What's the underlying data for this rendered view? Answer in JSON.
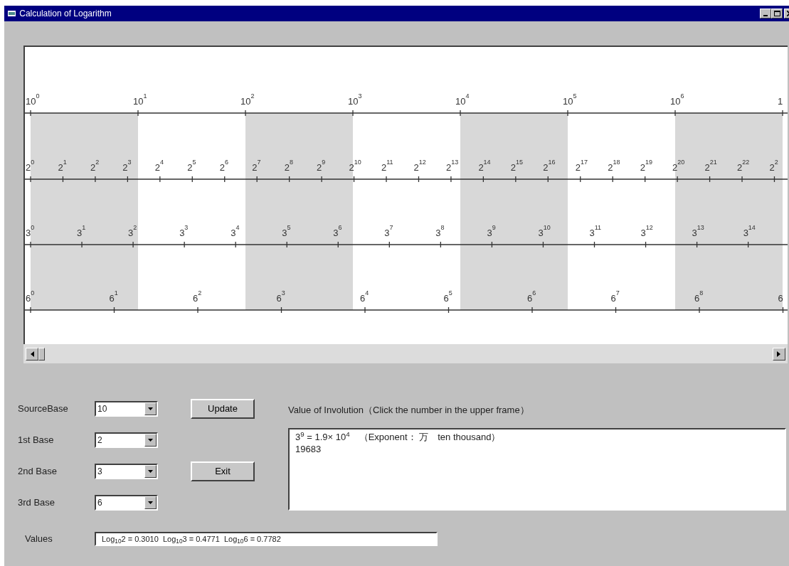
{
  "window": {
    "title": "Calculation of Logarithm"
  },
  "bands": [
    {
      "shaded": true
    },
    {
      "shaded": false
    },
    {
      "shaded": true
    },
    {
      "shaded": false
    },
    {
      "shaded": true
    },
    {
      "shaded": false
    },
    {
      "shaded": true
    }
  ],
  "scales": [
    {
      "labels": [
        {
          "base": "10",
          "exp": "0"
        },
        {
          "base": "10",
          "exp": "1"
        },
        {
          "base": "10",
          "exp": "2"
        },
        {
          "base": "10",
          "exp": "3"
        },
        {
          "base": "10",
          "exp": "4"
        },
        {
          "base": "10",
          "exp": "5"
        },
        {
          "base": "10",
          "exp": "6"
        },
        {
          "base": "1"
        }
      ]
    },
    {
      "labels": [
        {
          "base": "2",
          "exp": "0"
        },
        {
          "base": "2",
          "exp": "1"
        },
        {
          "base": "2",
          "exp": "2"
        },
        {
          "base": "2",
          "exp": "3"
        },
        {
          "base": "2",
          "exp": "4"
        },
        {
          "base": "2",
          "exp": "5"
        },
        {
          "base": "2",
          "exp": "6"
        },
        {
          "base": "2",
          "exp": "7"
        },
        {
          "base": "2",
          "exp": "8"
        },
        {
          "base": "2",
          "exp": "9"
        },
        {
          "base": "2",
          "exp": "10"
        },
        {
          "base": "2",
          "exp": "11"
        },
        {
          "base": "2",
          "exp": "12"
        },
        {
          "base": "2",
          "exp": "13"
        },
        {
          "base": "2",
          "exp": "14"
        },
        {
          "base": "2",
          "exp": "15"
        },
        {
          "base": "2",
          "exp": "16"
        },
        {
          "base": "2",
          "exp": "17"
        },
        {
          "base": "2",
          "exp": "18"
        },
        {
          "base": "2",
          "exp": "19"
        },
        {
          "base": "2",
          "exp": "20"
        },
        {
          "base": "2",
          "exp": "21"
        },
        {
          "base": "2",
          "exp": "22"
        },
        {
          "base": "2",
          "exp": "2"
        }
      ]
    },
    {
      "labels": [
        {
          "base": "3",
          "exp": "0"
        },
        {
          "base": "3",
          "exp": "1"
        },
        {
          "base": "3",
          "exp": "2"
        },
        {
          "base": "3",
          "exp": "3"
        },
        {
          "base": "3",
          "exp": "4"
        },
        {
          "base": "3",
          "exp": "5"
        },
        {
          "base": "3",
          "exp": "6"
        },
        {
          "base": "3",
          "exp": "7"
        },
        {
          "base": "3",
          "exp": "8"
        },
        {
          "base": "3",
          "exp": "9"
        },
        {
          "base": "3",
          "exp": "10"
        },
        {
          "base": "3",
          "exp": "11"
        },
        {
          "base": "3",
          "exp": "12"
        },
        {
          "base": "3",
          "exp": "13"
        },
        {
          "base": "3",
          "exp": "14"
        }
      ]
    },
    {
      "labels": [
        {
          "base": "6",
          "exp": "0"
        },
        {
          "base": "6",
          "exp": "1"
        },
        {
          "base": "6",
          "exp": "2"
        },
        {
          "base": "6",
          "exp": "3"
        },
        {
          "base": "6",
          "exp": "4"
        },
        {
          "base": "6",
          "exp": "5"
        },
        {
          "base": "6",
          "exp": "6"
        },
        {
          "base": "6",
          "exp": "7"
        },
        {
          "base": "6",
          "exp": "8"
        },
        {
          "base": "6"
        }
      ]
    }
  ],
  "combos": [
    {
      "label": "SourceBase",
      "value": "10"
    },
    {
      "label": "1st Base",
      "value": "2"
    },
    {
      "label": "2nd Base",
      "value": "3"
    },
    {
      "label": "3rd Base",
      "value": "6"
    }
  ],
  "buttons": [
    "Update",
    "Exit"
  ],
  "involution": {
    "label": "Value of Involution（Click the number in the upper frame）",
    "lines": [
      "3$^{9}$ = 1.9× 10$^{4}$　（Exponent： 万　ten thousand）",
      "19683"
    ]
  },
  "values": {
    "label": "Values",
    "text": "Log$_{10}$2 = 0.3010  Log$_{10}$3 = 0.4771  Log$_{10}$6 = 0.7782"
  }
}
